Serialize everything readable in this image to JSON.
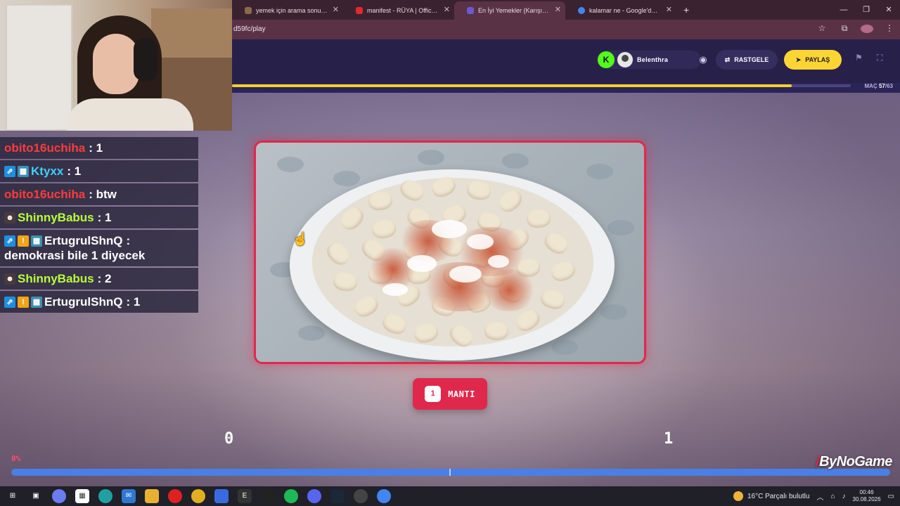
{
  "browser": {
    "tabs": [
      {
        "label": "yemek için arama sonuçları - Q",
        "favicon_color": "#8a6a4a",
        "active": false
      },
      {
        "label": "manifest - RÜYA | Official Musi",
        "favicon_color": "#e02b2b",
        "active": false
      },
      {
        "label": "En İyi Yemekler (Karışık) - Tier L",
        "favicon_color": "#6a5acd",
        "active": true
      },
      {
        "label": "kalamar ne - Google'da Ara",
        "favicon_color": "#4285f4",
        "active": false
      }
    ],
    "url": "d59fc/play"
  },
  "header": {
    "kick_letter": "K",
    "username": "Belenthra",
    "random_label": "RASTGELE",
    "share_label": "PAYLAŞ",
    "match_prefix": "MAÇ",
    "match_current": "57",
    "match_total": "/63",
    "progress_fraction": 0.905
  },
  "chat": [
    {
      "user": "obito16uchiha",
      "user_color": "#ff3b3b",
      "badges": [],
      "text": ": 1"
    },
    {
      "user": "Ktyxx",
      "user_color": "#3fd0ff",
      "badges": [
        "ext",
        "sub"
      ],
      "text": ": 1"
    },
    {
      "user": "obito16uchiha",
      "user_color": "#ff3b3b",
      "badges": [],
      "text": ": btw"
    },
    {
      "user": "ShinnyBabus",
      "user_color": "#b9ff3a",
      "badges": [
        "face"
      ],
      "text": ": 1"
    },
    {
      "user": "ErtugrulShnQ",
      "user_color": "#ffffff",
      "badges": [
        "ext",
        "gift",
        "sub"
      ],
      "text": ":",
      "cont": "demokrasi bile 1 diyecek"
    },
    {
      "user": "ShinnyBabus",
      "user_color": "#b9ff3a",
      "badges": [
        "face"
      ],
      "text": ": 2"
    },
    {
      "user": "ErtugrulShnQ",
      "user_color": "#ffffff",
      "badges": [
        "ext",
        "gift",
        "sub"
      ],
      "text": ": 1"
    }
  ],
  "game": {
    "item_number": "1",
    "item_name": "MANTI",
    "score_left": "0",
    "score_right": "1",
    "vote_percent_label": "0%",
    "vote_fraction": 0.0,
    "brand_slash": "/",
    "brand_name": "ByNoGame"
  },
  "taskbar": {
    "weather": "16°C  Parçalı bulutlu",
    "time": "00:46",
    "date": "30.08.2026"
  },
  "colors": {
    "accent_red": "#e0284c",
    "accent_yellow": "#fcd535",
    "kick_green": "#53fc18",
    "vote_blue": "#4a7fe5"
  }
}
